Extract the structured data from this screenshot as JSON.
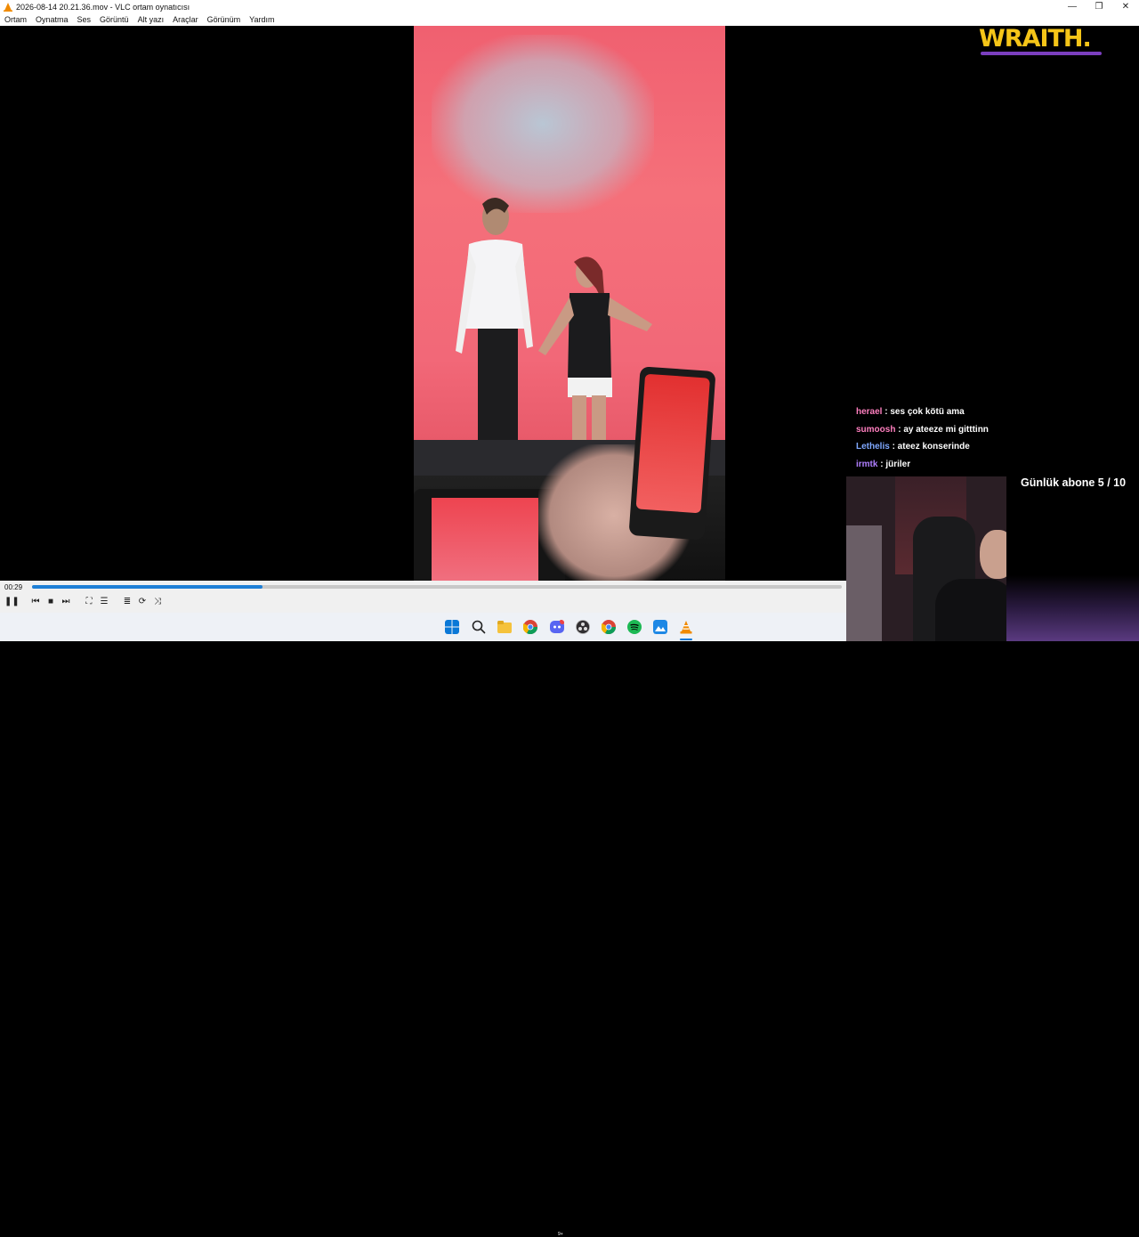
{
  "window": {
    "title": "2026-08-14 20.21.36.mov - VLC ortam oynatıcısı",
    "controls": [
      "—",
      "❐",
      "✕"
    ]
  },
  "menu": [
    "Ortam",
    "Oynatma",
    "Ses",
    "Görüntü",
    "Alt yazı",
    "Araçlar",
    "Görünüm",
    "Yardım"
  ],
  "overlay": {
    "logo_text": "WRAITH.",
    "logo_color": "#f5c518",
    "logo_accent": "#7b3fbf",
    "chat": [
      {
        "user": "herael",
        "color": "#ff7fbf",
        "message": ": ses çok kötü ama"
      },
      {
        "user": "sumoosh",
        "color": "#ff7fbf",
        "message": ": ay ateeze mi gitttinn"
      },
      {
        "user": "Lethelis",
        "color": "#7fa8ff",
        "message": ": ateez konserinde"
      },
      {
        "user": "irmtk",
        "color": "#b07fff",
        "message": ": jüriler"
      }
    ],
    "sub_goal": "Günlük abone 5 / 10"
  },
  "player": {
    "elapsed": "00:29",
    "progress_fraction": 0.285,
    "accent": "#1e7fd6"
  },
  "taskbar": {
    "icons": [
      "windows-start-icon",
      "search-icon",
      "file-explorer-icon",
      "chrome-icon",
      "discord-icon",
      "obs-icon",
      "chrome-icon",
      "spotify-icon",
      "photos-icon",
      "vlc-icon"
    ],
    "discord_badge": "9+"
  }
}
